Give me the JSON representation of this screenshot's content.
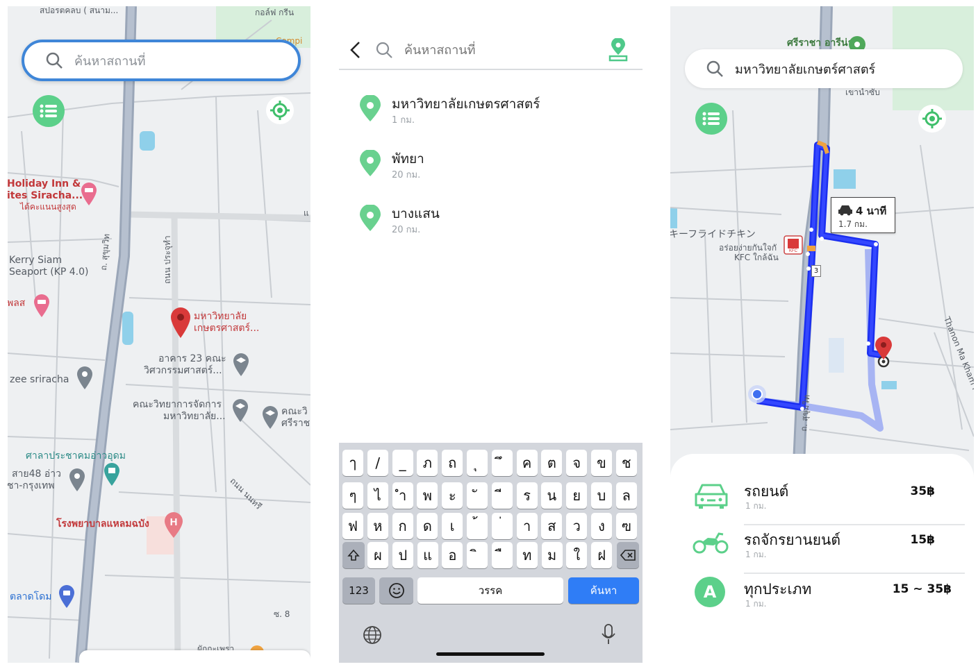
{
  "screen_map": {
    "search_placeholder": "ค้นหาสถานที่",
    "labels": {
      "top_label": "สปอรตคลบ ( สนาม...",
      "golf": "กอล์ฟ กรีน",
      "compi": "Compi",
      "holiday_line1": "Holiday Inn &",
      "holiday_line2": "ites Siracha...",
      "holiday_sub": "ได้คะแนนสูงสุด",
      "kerry_line1": "Kerry Siam",
      "kerry_line2": "Seaport (KP 4.0)",
      "plaa": "พลส",
      "university_line1": "มหาวิทยาลัย",
      "university_line2": "เกษตรศาสตร์...",
      "building23_line1": "อาคาร 23 คณะ",
      "building23_line2": "วิศวกรรมศาสตร์...",
      "zee": "zee sriracha",
      "mgmt_line1": "คณะวิทยาการจัดการ",
      "mgmt_line2": "มหาวิทยาลัย...",
      "faculty_line1": "คณะวิ",
      "faculty_line2": "ศรีราช",
      "sala": "ศาลาประชาคมอ่าวอุดม",
      "bus_line1": "สาย48 อ่าว",
      "bus_line2": "ชา-กรุงเทพ",
      "hospital": "โรงพยาบาลแหลมฉบัง",
      "market": "ตลาดโดม",
      "road_sukhumvit": "ถ. สุขุมวิท",
      "road_prachut": "ถนน ประจุทำ",
      "road_nonsri": "ถนน นนทรี",
      "soi8": "ซ. 8",
      "vege": "ผักกะเพรา",
      "edge_char": "แ"
    }
  },
  "screen_search": {
    "placeholder": "ค้นหาสถานที่",
    "results": [
      {
        "title": "มหาวิทยาลัยเกษตรศาสตร์",
        "distance": "1 กม."
      },
      {
        "title": "พัทยา",
        "distance": "20 กม."
      },
      {
        "title": "บางแสน",
        "distance": "20 กม."
      }
    ],
    "keyboard": {
      "row1": [
        "ๅ",
        "/",
        "_",
        "ภ",
        "ถ",
        "ุ",
        "ึ",
        "ค",
        "ต",
        "จ",
        "ข",
        "ช"
      ],
      "row2": [
        "ๆ",
        "ไ",
        "ำ",
        "พ",
        "ะ",
        "ั",
        "ี",
        "ร",
        "น",
        "ย",
        "บ",
        "ล"
      ],
      "row3": [
        "ฟ",
        "ห",
        "ก",
        "ด",
        "เ",
        "้",
        "่",
        "า",
        "ส",
        "ว",
        "ง",
        "ฃ"
      ],
      "row4": [
        "ผ",
        "ป",
        "แ",
        "อ",
        "ิ",
        "ื",
        "ท",
        "ม",
        "ใ",
        "ฝ"
      ],
      "numbers_label": "123",
      "space_label": "วรรค",
      "search_label": "ค้นหา"
    }
  },
  "screen_route": {
    "search_value": "มหาวิทยาลัยเกษตร์ศาสตร์",
    "map_labels": {
      "sriracha": "ศรีราชา อารีน่า",
      "khao": "เขาน้ำซับ",
      "kfc_jp": "キーフライドチキン",
      "kfc_th": "อร่อยง่ายกันใจกั",
      "kfc_sub": "KFC ใกล้ฉัน",
      "thanon": "Thanon Ma Kham Pom",
      "sukhumvit": "ถ. สุขุมวิท",
      "route_no": "3"
    },
    "route_callout": {
      "time": "4 นาที",
      "distance": "1.7 กม."
    },
    "vehicles": [
      {
        "name": "รถยนต์",
        "distance": "1 กม.",
        "price": "35฿",
        "icon": "car-icon"
      },
      {
        "name": "รถจักรยานยนต์",
        "distance": "1 กม.",
        "price": "15฿",
        "icon": "motorcycle-icon"
      },
      {
        "name": "ทุกประเภท",
        "distance": "1 กม.",
        "price": "15 ~ 35฿",
        "icon": "all-types-icon",
        "badge": "A"
      }
    ]
  },
  "colors": {
    "accent_green": "#5cd08a",
    "route_blue": "#1b2ff0",
    "search_focus_blue": "#3f86d8",
    "keyboard_blue": "#2f7df6",
    "pin_red": "#d93a3a"
  }
}
